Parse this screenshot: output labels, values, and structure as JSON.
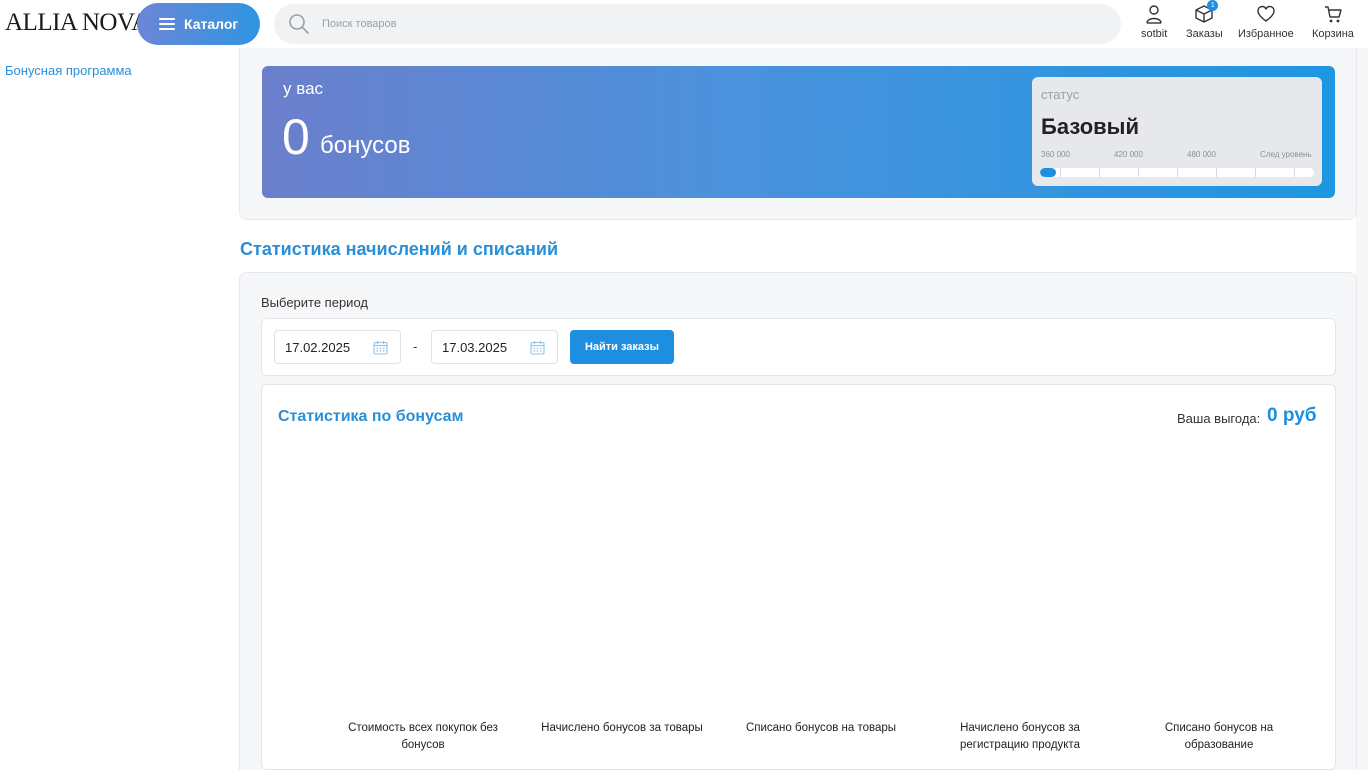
{
  "header": {
    "logo": "ALLIA NOVA",
    "catalog_label": "Каталог",
    "search_placeholder": "Поиск товаров",
    "user_label": "sotbit",
    "orders_label": "Заказы",
    "orders_badge": "1",
    "favorites_label": "Избранное",
    "cart_label": "Корзина",
    "icons": [
      "hamburger-icon",
      "search-icon",
      "user-icon",
      "box-icon",
      "heart-icon",
      "cart-icon",
      "calendar-icon"
    ]
  },
  "sidebar": {
    "items": [
      {
        "label": "Бонусная программа",
        "active": true
      }
    ]
  },
  "bonus": {
    "label": "у вас",
    "value": "0",
    "unit": "бонусов",
    "status_label": "статус",
    "status_name": "Базовый",
    "levels": [
      "360 000",
      "420 000",
      "480 000",
      "След уровень"
    ],
    "progress": 0.05
  },
  "stats": {
    "section_title": "Статистика начислений и списаний",
    "period_label": "Выберите период",
    "date_from": "17.02.2025",
    "date_separator": "-",
    "date_to": "17.03.2025",
    "find_button": "Найти заказы",
    "chart_title": "Статистика по бонусам",
    "benefit_label": "Ваша выгода:",
    "benefit_value": "0 руб"
  },
  "colors": {
    "accent": "#1e8fe0",
    "title_blue": "#2a8fd6",
    "gradient_start": "#6b7fcc",
    "gradient_end": "#1e96e2"
  },
  "chart_data": {
    "type": "bar",
    "categories": [
      "Стоимость всех покупок без бонусов",
      "Начислено бонусов за товары",
      "Списано бонусов на товары",
      "Начислено бонусов за регистрацию продукта",
      "Списано бонусов на образование"
    ],
    "values": [
      0,
      0,
      0,
      0,
      0
    ],
    "title": "Статистика по бонусам",
    "xlabel": "",
    "ylabel": ""
  }
}
